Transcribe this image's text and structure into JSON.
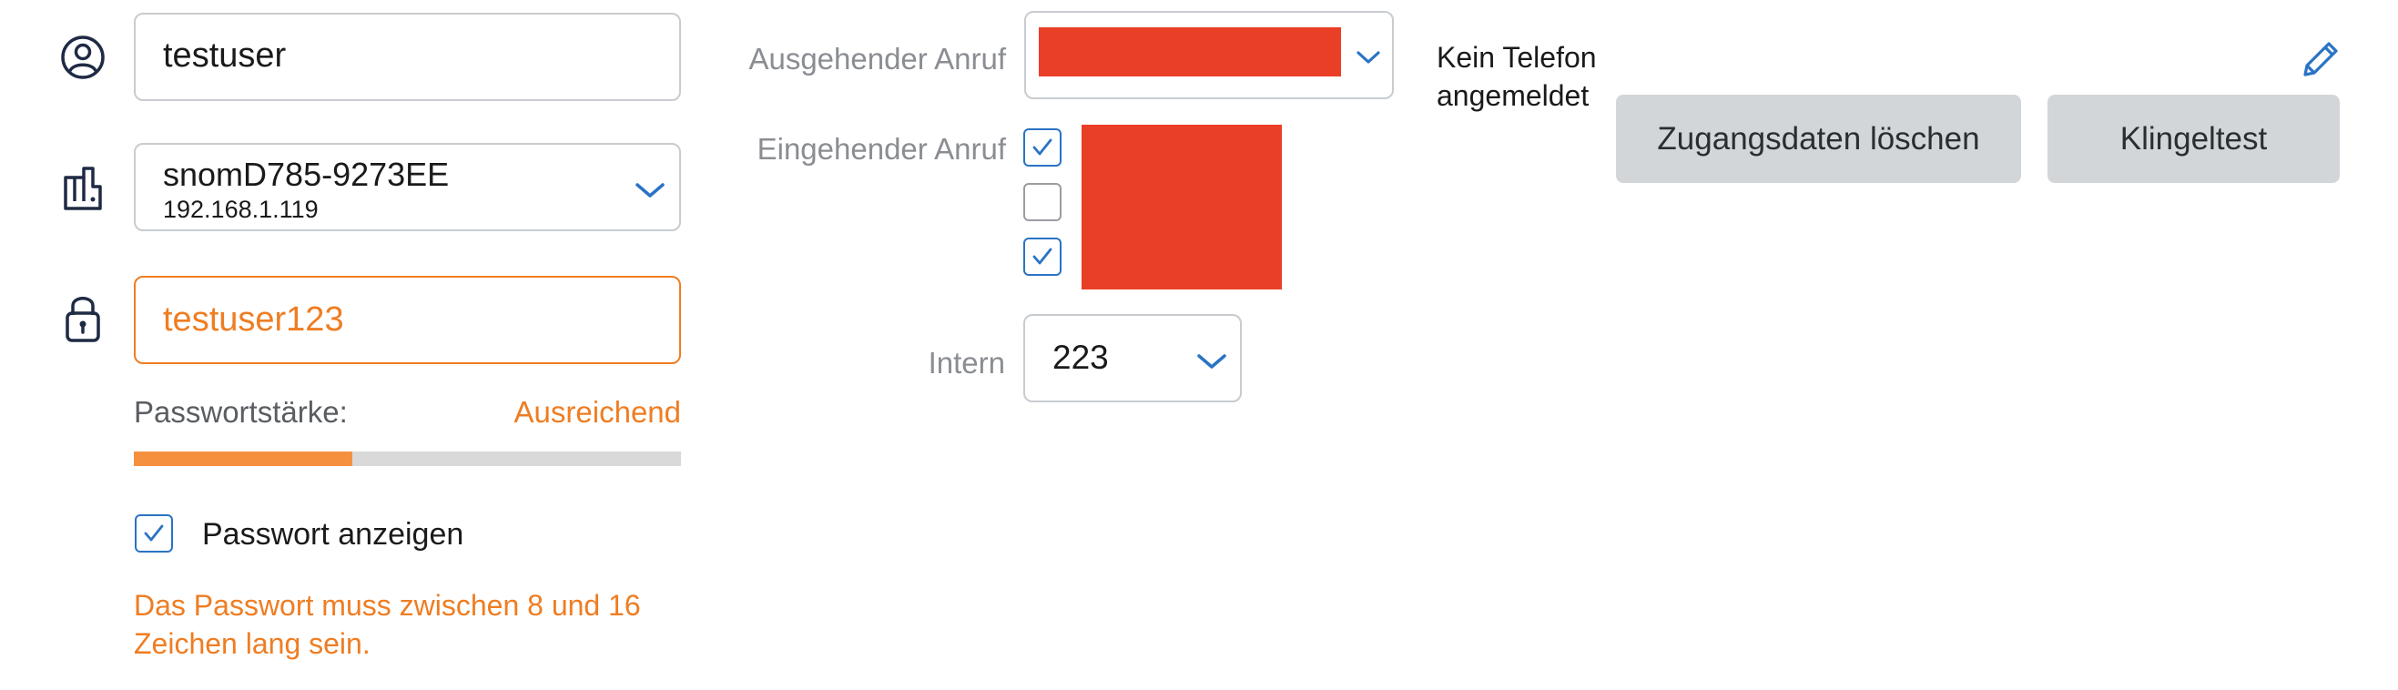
{
  "account": {
    "username": "testuser",
    "device_name": "snomD785-9273EE",
    "device_ip": "192.168.1.119",
    "password": "testuser123",
    "password_strength_label": "Passwortstärke:",
    "password_strength_value": "Ausreichend",
    "password_strength_percent": 40,
    "show_password_label": "Passwort anzeigen",
    "show_password_checked": true,
    "password_hint_line1": "Das Passwort muss zwischen 8 und 16",
    "password_hint_line2": "Zeichen lang sein."
  },
  "calls": {
    "outgoing_label": "Ausgehender Anruf",
    "incoming_label": "Eingehender Anruf",
    "incoming_checks": [
      true,
      false,
      true
    ],
    "intern_label": "Intern",
    "intern_value": "223"
  },
  "status": {
    "line1": "Kein Telefon",
    "line2": "angemeldet"
  },
  "actions": {
    "delete_credentials": "Zugangsdaten löschen",
    "ring_test": "Klingeltest"
  },
  "colors": {
    "accent_blue": "#2a73c5",
    "warning_orange": "#ef7d22",
    "redaction_red": "#ea3f27",
    "button_gray": "#d3d6d9"
  },
  "icons": [
    "user-icon",
    "phone-device-icon",
    "lock-icon",
    "chevron-down-icon",
    "pencil-icon",
    "checkmark-icon"
  ]
}
